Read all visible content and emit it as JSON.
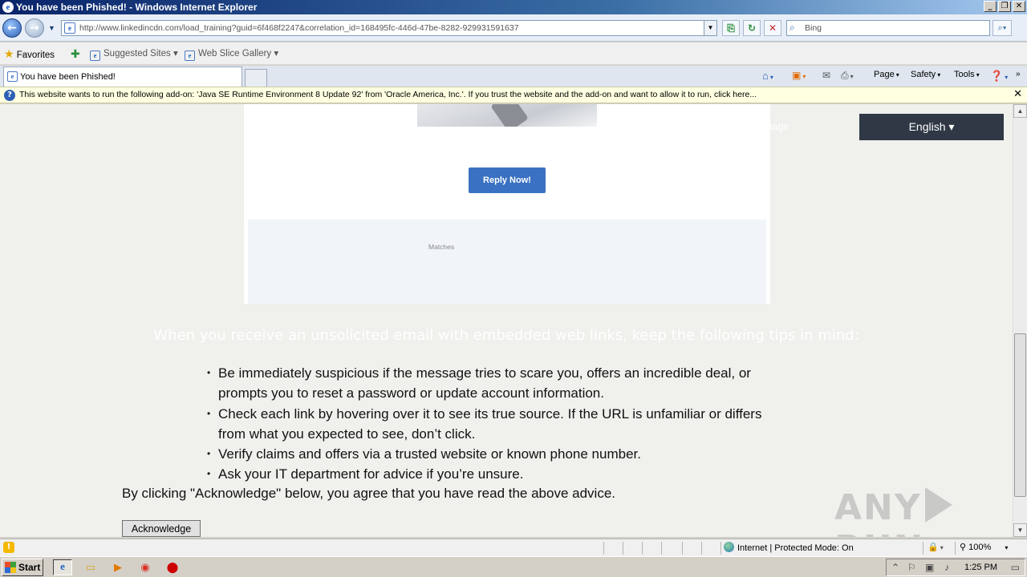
{
  "window": {
    "title": "You have been Phished! - Windows Internet Explorer",
    "buttons": [
      "_",
      "❐",
      "✕"
    ]
  },
  "address_bar": {
    "url": "http://www.linkedincdn.com/load_training?guid=6f468f2247&correlation_id=168495fc-446d-47be-8282-929931591637",
    "search_placeholder": "Bing"
  },
  "favorites_bar": {
    "favorites_label": "Favorites",
    "suggested_sites": "Suggested Sites",
    "web_slice_gallery": "Web Slice Gallery"
  },
  "tabs": [
    {
      "label": "You have been Phished!"
    }
  ],
  "command_bar": {
    "page": "Page",
    "safety": "Safety",
    "tools": "Tools"
  },
  "info_bar": {
    "message": "This website wants to run the following add-on: 'Java SE Runtime Environment 8 Update 92' from 'Oracle America, Inc.'. If you trust the website and the add-on and want to allow it to run, click here..."
  },
  "page": {
    "reply_button": "Reply Now!",
    "matches_label": "Matches",
    "faded_language_text": "uage",
    "language_button": "English ▾",
    "tips_heading": "When you receive an unsolicited email with embedded web links, keep the following tips in mind:",
    "tips": [
      "Be immediately suspicious if the message tries to scare you, offers an incredible deal, or prompts you to reset a password or update account information.",
      "Check each link by hovering over it to see its true source. If the URL is unfamiliar or differs from what you expected to see, don’t click.",
      "Verify claims and offers via a trusted website or known phone number.",
      "Ask your IT department for advice if you’re unsure."
    ],
    "agreement": "By clicking \"Acknowledge\" below, you agree that you have read the above advice.",
    "acknowledge_button": "Acknowledge",
    "watermark": "ANY RUN"
  },
  "status_bar": {
    "zone": "Internet | Protected Mode: On",
    "zoom": "100%"
  },
  "taskbar": {
    "start_label": "Start",
    "clock": "1:25 PM"
  },
  "colors": {
    "reply_button": "#3b71c2",
    "language_button": "#2f3844",
    "info_bar": "#ffffe1"
  }
}
